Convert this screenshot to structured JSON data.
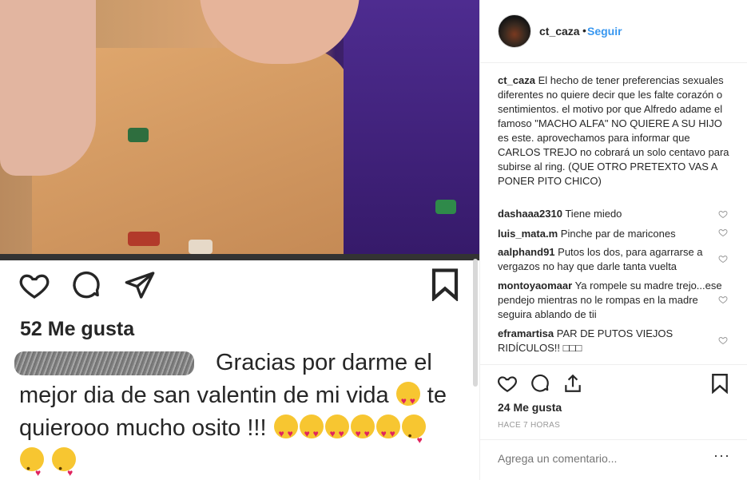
{
  "post_image": {
    "likes_text": "52 Me gusta",
    "caption_user": "sebas_gamer17",
    "caption_line1": "Gracias por darme el",
    "caption_line2": "mejor dia de san valentin de mi vida",
    "caption_line2b": "te",
    "caption_line3": "quierooo mucho osito !!!"
  },
  "header": {
    "username": "ct_caza",
    "separator": "•",
    "follow_label": "Seguir"
  },
  "caption": {
    "username": "ct_caza",
    "text": "El hecho de tener preferencias sexuales diferentes no quiere decir que les falte corazón o sentimientos. el motivo por que Alfredo adame el famoso \"MACHO ALFA\" NO QUIERE A SU HIJO es este. aprovechamos para informar que CARLOS TREJO no cobrará un solo centavo para subirse al ring. (QUE OTRO PRETEXTO VAS A PONER PITO CHICO)"
  },
  "comments": [
    {
      "user": "dashaaa2310",
      "text": "Tiene miedo"
    },
    {
      "user": "luis_mata.m",
      "text": "Pinche par de maricones"
    },
    {
      "user": "aalphand91",
      "text": "Putos los dos, para agarrarse a vergazos no hay que darle tanta vuelta"
    },
    {
      "user": "montoyaomaar",
      "text": "Ya rompele su madre trejo...ese pendejo mientras no le rompas en la madre seguira ablando de tii"
    },
    {
      "user": "eframartisa",
      "text": "PAR DE PUTOS VIEJOS RIDÍCULOS!! □□□"
    }
  ],
  "likes": "24 Me gusta",
  "time": "HACE 7 HORAS",
  "comment_input": {
    "placeholder": "Agrega un comentario..."
  },
  "more_label": "···",
  "icons": [
    "heart-icon",
    "comment-icon",
    "share-icon",
    "bookmark-icon",
    "more-options-icon"
  ],
  "colors": {
    "follow": "#3897f0",
    "text": "#262626",
    "muted": "#999999"
  }
}
